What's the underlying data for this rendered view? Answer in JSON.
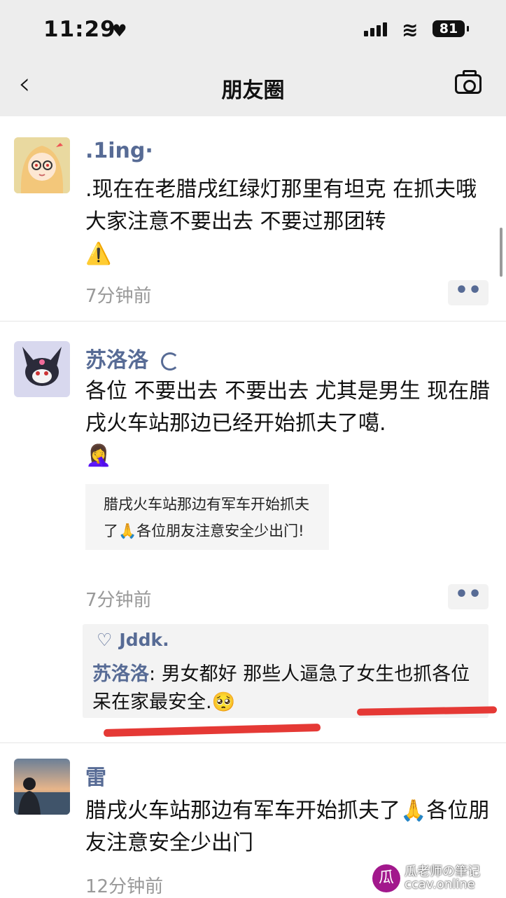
{
  "status_bar": {
    "time": "11:29",
    "battery": "81"
  },
  "nav": {
    "title": "朋友圈"
  },
  "posts": [
    {
      "name": ".1ing·",
      "content": ".现在在老腊戌红绿灯那里有坦克 在抓夫哦 大家注意不要出去 不要过那团转",
      "emoji": "⚠️",
      "time": "7分钟前",
      "more": "••"
    },
    {
      "name": "苏洛洛",
      "content": "各位 不要出去 不要出去 尤其是男生 现在腊戌火车站那边已经开始抓夫了噶.",
      "emoji": "🤦‍♀️",
      "quote": "腊戌火车站那边有军车开始抓夫了🙏各位朋友注意安全少出门!",
      "time": "7分钟前",
      "more": "••",
      "likes": "Jddk.",
      "comment": {
        "author": "苏洛洛",
        "text": "男女都好 那些人逼急了女生也抓各位呆在家最安全.🥺"
      }
    },
    {
      "name": "雷",
      "content": "腊戌火车站那边有军车开始抓夫了🙏各位朋友注意安全少出门",
      "time": "12分钟前"
    }
  ],
  "watermark": {
    "line1": "瓜老师の筆记",
    "line2": "ccav.online"
  },
  "colors": {
    "name": "#576b95",
    "bar": "#ededed",
    "highlight": "#e53935"
  }
}
